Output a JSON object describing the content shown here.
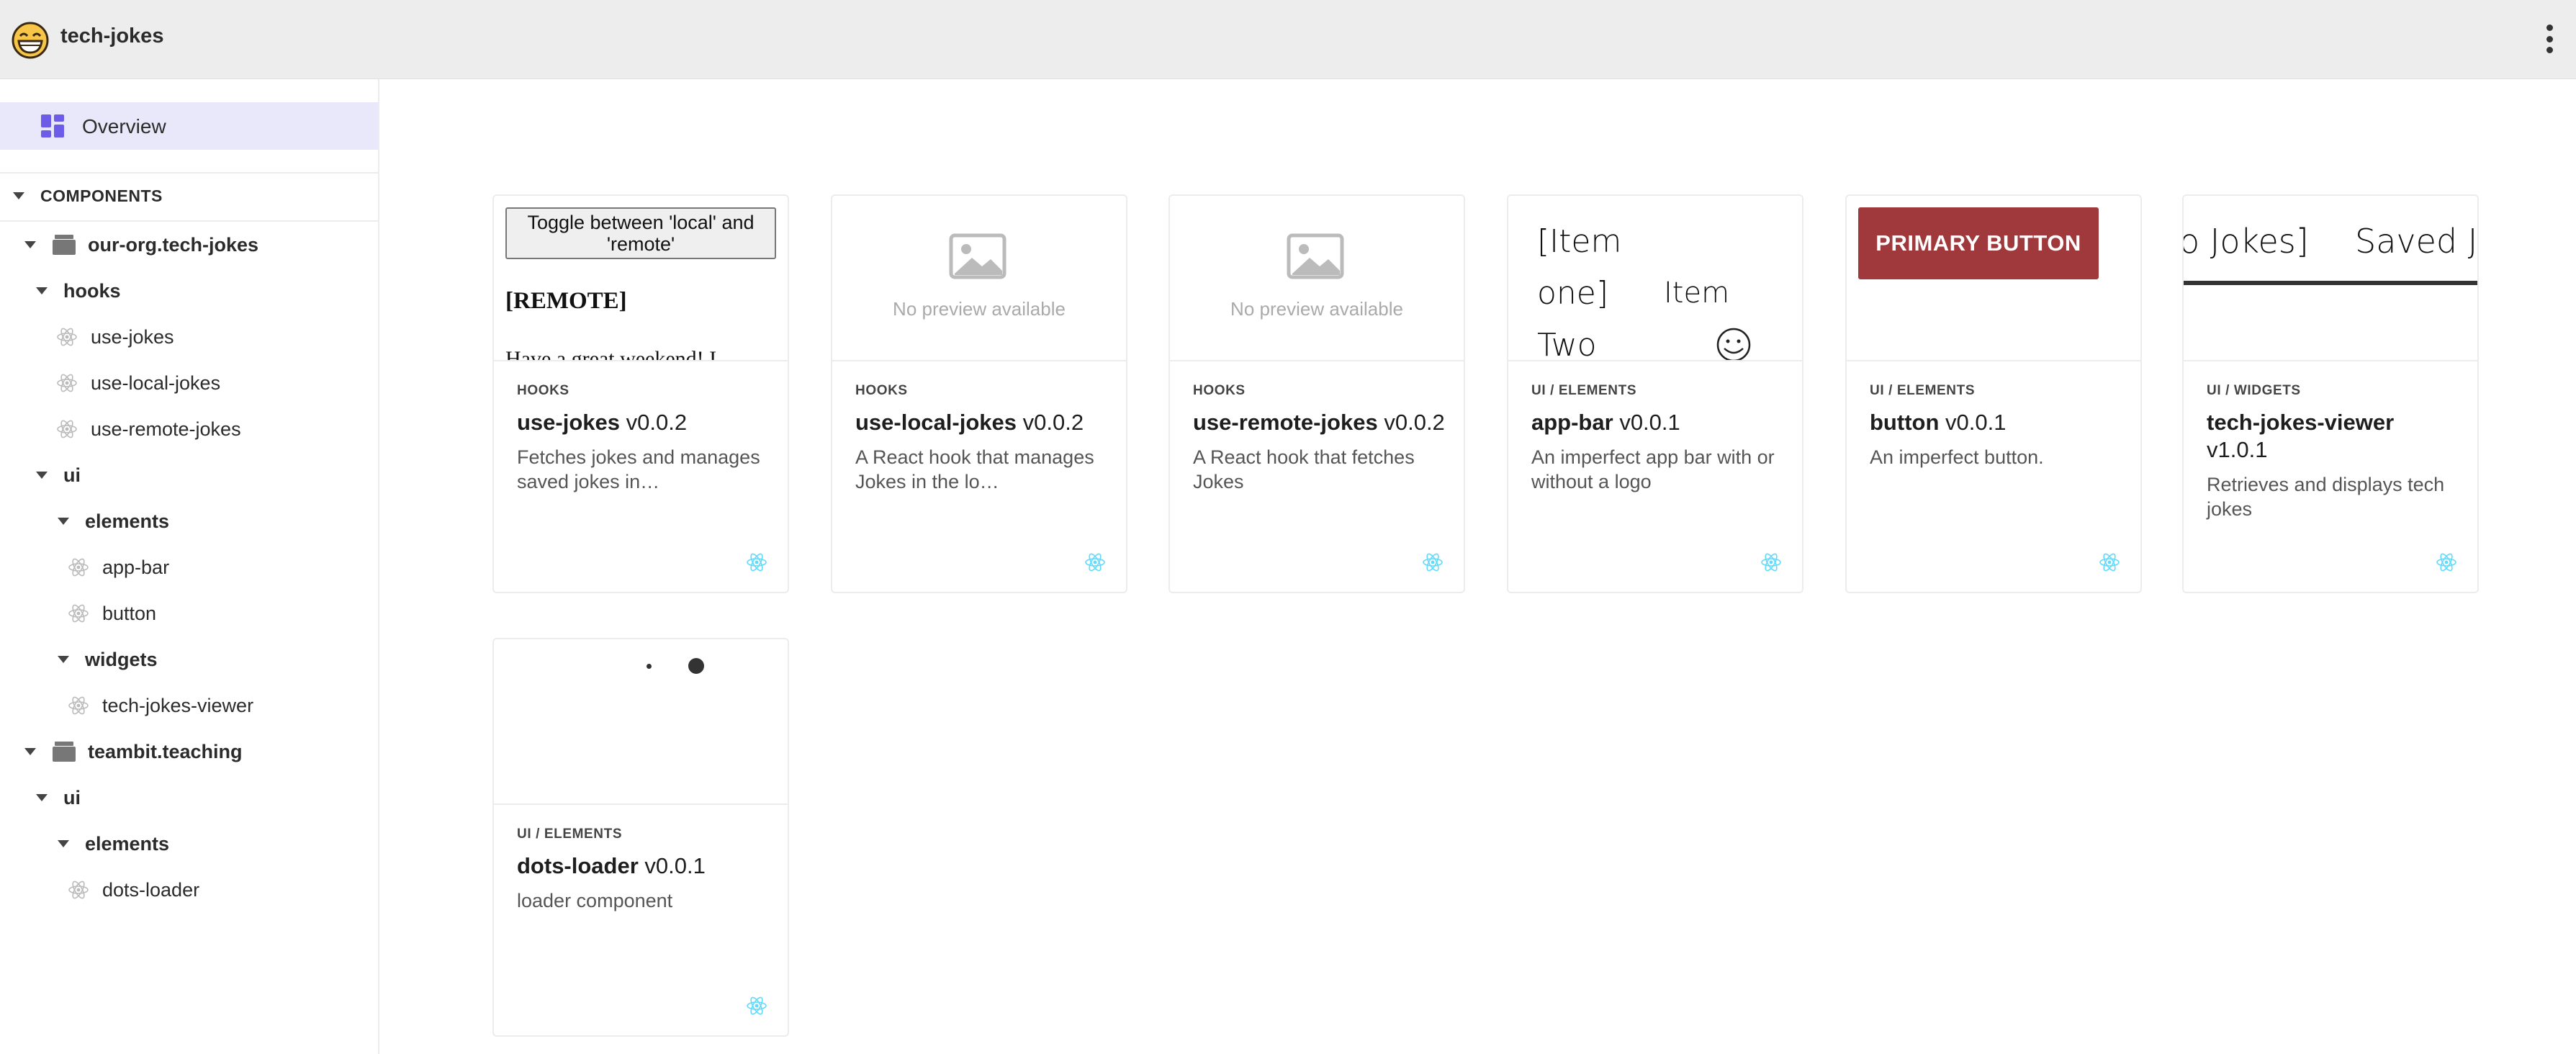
{
  "header": {
    "title": "tech-jokes",
    "logo_icon": "grinning-face-icon",
    "menu_icon": "more-vertical-icon"
  },
  "sidebar": {
    "overview_label": "Overview",
    "section_label": "COMPONENTS",
    "scopes": [
      {
        "name": "our-org.tech-jokes",
        "groups": [
          {
            "name": "hooks",
            "items": [
              "use-jokes",
              "use-local-jokes",
              "use-remote-jokes"
            ]
          },
          {
            "name": "ui",
            "subgroups": [
              {
                "name": "elements",
                "items": [
                  "app-bar",
                  "button"
                ]
              },
              {
                "name": "widgets",
                "items": [
                  "tech-jokes-viewer"
                ]
              }
            ]
          }
        ]
      },
      {
        "name": "teambit.teaching",
        "groups": [
          {
            "name": "ui",
            "subgroups": [
              {
                "name": "elements",
                "items": [
                  "dots-loader"
                ]
              }
            ]
          }
        ]
      }
    ]
  },
  "cards": [
    {
      "category": "HOOKS",
      "name": "use-jokes",
      "version": "v0.0.2",
      "desc": "Fetches jokes and manages saved jokes in…",
      "preview": {
        "button": "Toggle between 'local' and 'remote'",
        "mode": "[REMOTE]",
        "joke": "Have a great weekend! I"
      }
    },
    {
      "category": "HOOKS",
      "name": "use-local-jokes",
      "version": "v0.0.2",
      "desc": "A React hook that manages Jokes in the lo…",
      "preview": {
        "empty": "No preview available"
      }
    },
    {
      "category": "HOOKS",
      "name": "use-remote-jokes",
      "version": "v0.0.2",
      "desc": "A React hook that fetches Jokes",
      "preview": {
        "empty": "No preview available"
      }
    },
    {
      "category": "UI / ELEMENTS",
      "name": "app-bar",
      "version": "v0.0.1",
      "desc": "An imperfect app bar with or without a logo",
      "preview": {
        "line1": "[Item",
        "line2": "one]",
        "line3": "Two",
        "item": "Item"
      }
    },
    {
      "category": "UI / ELEMENTS",
      "name": "button",
      "version": "v0.0.1",
      "desc": "An imperfect button.",
      "preview": {
        "button": "PRIMARY BUTTON"
      }
    },
    {
      "category": "UI / WIDGETS",
      "name": "tech-jokes-viewer",
      "version": "v1.0.1",
      "desc": "Retrieves and displays tech jokes",
      "preview": {
        "tab1": "o Jokes]",
        "tab2": "Saved J"
      }
    },
    {
      "category": "UI / ELEMENTS",
      "name": "dots-loader",
      "version": "v0.0.1",
      "desc": "loader component",
      "preview": {}
    }
  ],
  "colors": {
    "accent": "#6c5ce7",
    "overview_bg": "#e9e8fb",
    "primary_button": "#a0393b",
    "react": "#61dafb",
    "topbar": "#ededed"
  }
}
